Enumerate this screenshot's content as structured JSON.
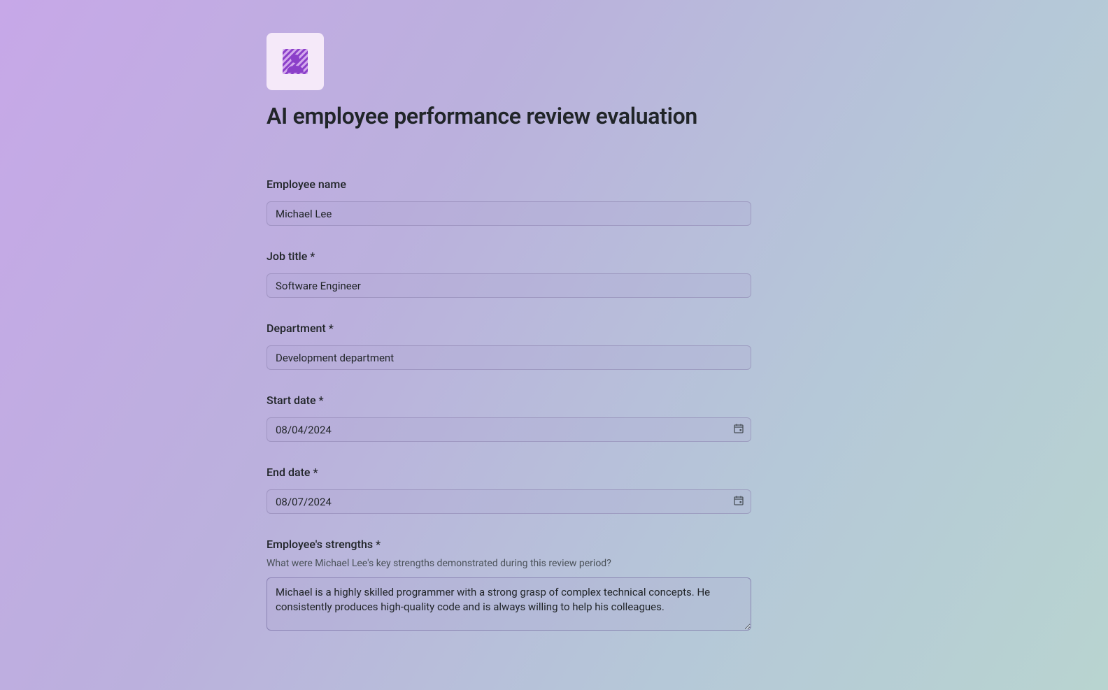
{
  "form": {
    "title": "AI employee performance review evaluation",
    "fields": {
      "employee_name": {
        "label": "Employee name",
        "value": "Michael Lee"
      },
      "job_title": {
        "label": "Job title *",
        "value": "Software Engineer"
      },
      "department": {
        "label": "Department *",
        "value": "Development department"
      },
      "start_date": {
        "label": "Start date *",
        "value": "08/04/2024"
      },
      "end_date": {
        "label": "End date *",
        "value": "08/07/2024"
      },
      "strengths": {
        "label": "Employee's strengths *",
        "description": "What were Michael Lee's key strengths demonstrated during this review period?",
        "value": "Michael is a highly skilled programmer with a strong grasp of complex technical concepts. He consistently produces high-quality code and is always willing to help his colleagues."
      }
    }
  }
}
